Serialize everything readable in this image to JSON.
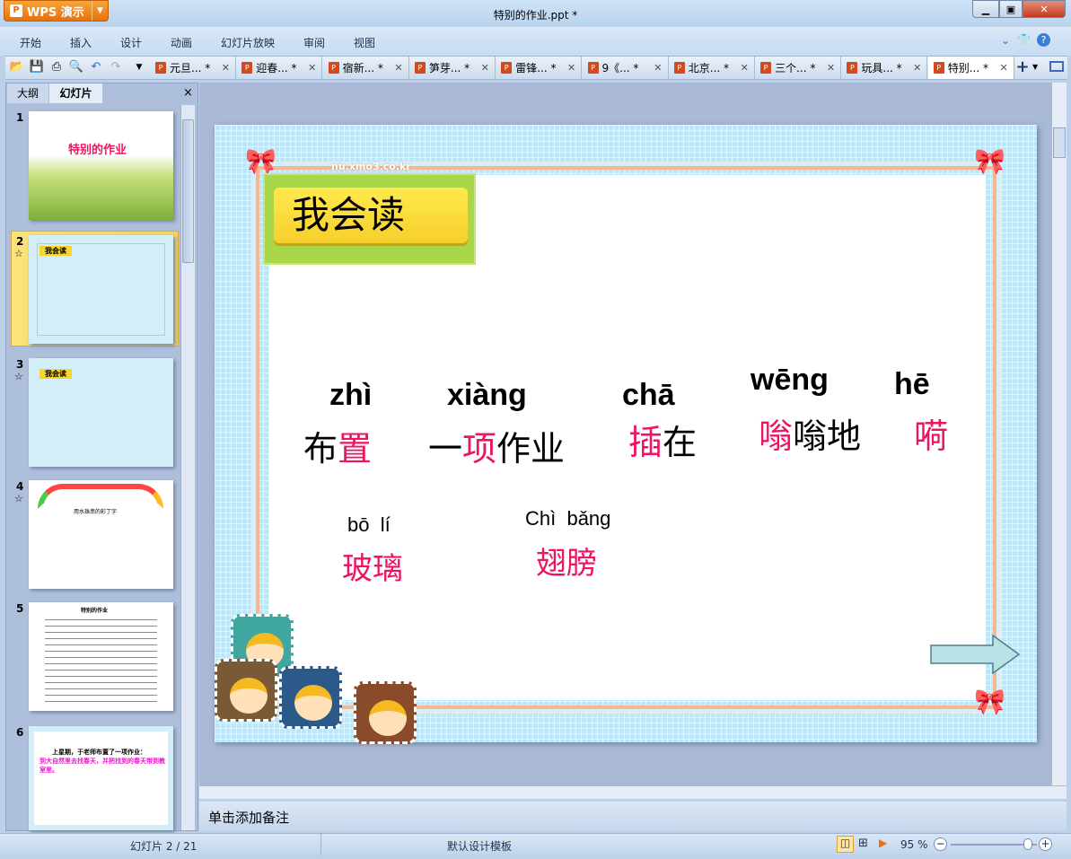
{
  "app": {
    "name": "WPS 演示",
    "title": "特别的作业.ppt *"
  },
  "menu": [
    "开始",
    "插入",
    "设计",
    "动画",
    "幻灯片放映",
    "审阅",
    "视图"
  ],
  "doc_tabs": [
    "元旦... *",
    "迎春... *",
    "宿新... *",
    "笋芽... *",
    "雷锋... *",
    "9《... *",
    "北京... *",
    "三个... *",
    "玩具... *",
    "特别... *"
  ],
  "panel": {
    "tabs": [
      "大纲",
      "幻灯片"
    ],
    "close": "×"
  },
  "thumbs": {
    "s1": {
      "num": "1",
      "title": "特别的作业"
    },
    "s2": {
      "num": "2",
      "title": "我会读"
    },
    "s3": {
      "num": "3",
      "title": "我会读"
    },
    "s4": {
      "num": "4",
      "text": "用水珠串的彩丁字"
    },
    "s5": {
      "num": "5",
      "title": "特别的作业"
    },
    "s6": {
      "num": "6",
      "line1": "上星期，于老师布置了一项作业：",
      "line2": "到大自然里去找春天，并把找到的春天带到教室里。"
    }
  },
  "slide": {
    "title": "我会读",
    "watermark": "nu.xmo3.co.kr",
    "words": [
      {
        "pinyin": "zhì",
        "a": "布",
        "b": "置",
        "c": ""
      },
      {
        "pinyin": "xiàng",
        "a": "一",
        "b": "项",
        "c": "作业"
      },
      {
        "pinyin": "chā",
        "a": "",
        "b": "插",
        "c": "在"
      },
      {
        "pinyin": "wēng",
        "a": "",
        "b": "嗡",
        "c": "嗡地"
      },
      {
        "pinyin": "hē",
        "a": "",
        "b": "嗬",
        "c": ""
      }
    ],
    "words2": [
      {
        "pinyin": "bō  lí",
        "hz": "玻璃"
      },
      {
        "pinyin": "Chì  bǎng",
        "hz": "翅膀"
      }
    ]
  },
  "notes_placeholder": "单击添加备注",
  "status": {
    "slide": "幻灯片 2 / 21",
    "template": "默认设计模板",
    "zoom": "95 %",
    "zoom_percent": 95
  },
  "colors": {
    "accent": "#ec1463",
    "wps_orange": "#e4720d"
  }
}
